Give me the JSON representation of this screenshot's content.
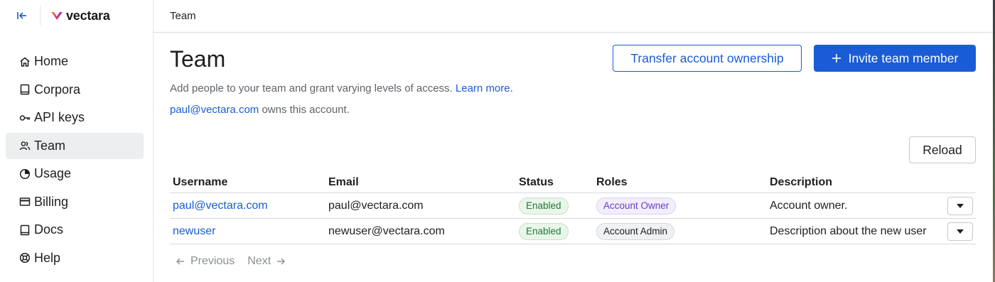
{
  "sidebar": {
    "logo_text": "vectara",
    "items": [
      {
        "label": "Home",
        "icon": "home-icon",
        "active": false
      },
      {
        "label": "Corpora",
        "icon": "book-icon",
        "active": false
      },
      {
        "label": "API keys",
        "icon": "key-icon",
        "active": false
      },
      {
        "label": "Team",
        "icon": "users-icon",
        "active": true
      },
      {
        "label": "Usage",
        "icon": "pie-chart-icon",
        "active": false
      },
      {
        "label": "Billing",
        "icon": "credit-card-icon",
        "active": false
      },
      {
        "label": "Docs",
        "icon": "book-icon",
        "active": false
      },
      {
        "label": "Help",
        "icon": "lifebuoy-icon",
        "active": false
      }
    ]
  },
  "topbar": {
    "title": "Team"
  },
  "main": {
    "title": "Team",
    "transfer_label": "Transfer account ownership",
    "invite_label": "Invite team member",
    "subtitle": "Add people to your team and grant varying levels of access.",
    "learn_more": "Learn more.",
    "owner_email": "paul@vectara.com",
    "owner_suffix": "owns this account.",
    "reload_label": "Reload"
  },
  "table": {
    "headers": {
      "username": "Username",
      "email": "Email",
      "status": "Status",
      "roles": "Roles",
      "description": "Description"
    },
    "rows": [
      {
        "username": "paul@vectara.com",
        "email": "paul@vectara.com",
        "status": "Enabled",
        "role": "Account Owner",
        "description": "Account owner."
      },
      {
        "username": "newuser",
        "email": "newuser@vectara.com",
        "status": "Enabled",
        "role": "Account Admin",
        "description": "Description about the new user"
      }
    ]
  },
  "pagination": {
    "previous": "Previous",
    "next": "Next"
  },
  "colors": {
    "accent": "#1a5cd6",
    "enabled": "#1e7b34",
    "owner_role": "#6a3ec2"
  }
}
